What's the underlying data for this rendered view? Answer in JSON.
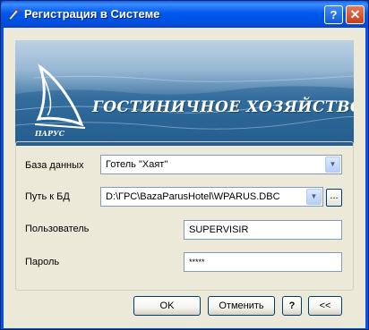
{
  "window": {
    "title": "Регистрация в Системе",
    "help_label": "?",
    "close_label": "✕"
  },
  "banner": {
    "title": "ГОСТИНИЧНОЕ ХОЗЯЙСТВО",
    "logo_caption": "ПАРУС"
  },
  "form": {
    "database": {
      "label": "База данных",
      "value": "Готель \"Хаят\""
    },
    "db_path": {
      "label": "Путь к БД",
      "value": "D:\\ГРС\\BazaParusHotel\\WPARUS.DBC",
      "browse_label": "..."
    },
    "user": {
      "label": "Пользователь",
      "value": "SUPERVISIR"
    },
    "password": {
      "label": "Пароль",
      "value": "*****"
    }
  },
  "buttons": {
    "ok": "OK",
    "cancel": "Отменить",
    "help": "?",
    "collapse": "<<"
  },
  "colors": {
    "titlebar": "#0054e3",
    "dialog_bg": "#ece9d8",
    "input_border": "#7f9db9"
  }
}
